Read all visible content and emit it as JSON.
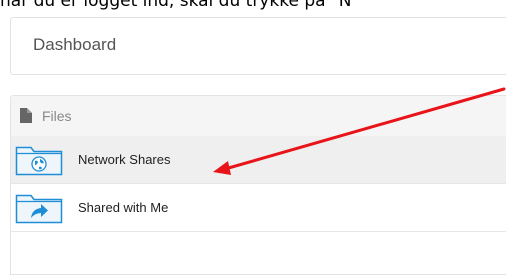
{
  "caption": "når du er logget ind, skal du trykke på \"N",
  "dashboard": {
    "title": "Dashboard"
  },
  "files": {
    "header": "Files",
    "header_icon": "file-icon",
    "items": [
      {
        "label": "Network Shares",
        "icon": "folder-globe-icon",
        "highlighted": true
      },
      {
        "label": "Shared with Me",
        "icon": "folder-share-icon",
        "highlighted": false
      }
    ]
  },
  "annotation": {
    "type": "arrow",
    "color": "#e8141a",
    "points_to": "Network Shares"
  },
  "colors": {
    "folder_blue": "#1e8ed6",
    "row_highlight": "#efefef",
    "arrow_red": "#e8141a"
  }
}
